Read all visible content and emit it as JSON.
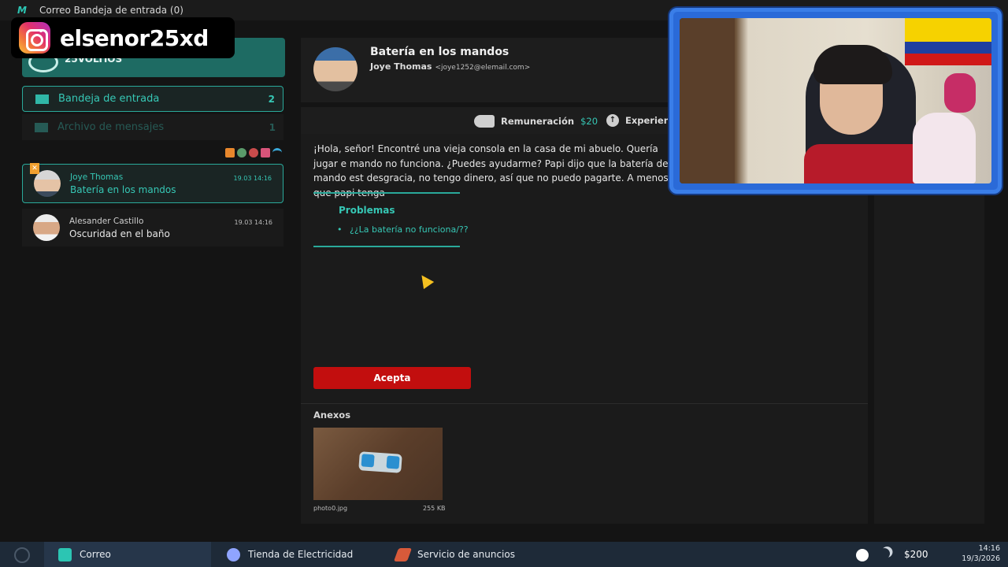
{
  "window": {
    "title": "Correo  Bandeja de entrada (0)",
    "app_logo": "M"
  },
  "overlay": {
    "instagram_handle": "elsenor25xd"
  },
  "sidebar": {
    "brand": "25VOLTIOS",
    "nav": [
      {
        "label": "Bandeja de entrada",
        "count": "2"
      },
      {
        "label": "Archivo de mensajes",
        "count": "1"
      }
    ],
    "status_icons": [
      "rss-icon",
      "globe-icon",
      "mail-icon",
      "heart-icon",
      "wifi-icon"
    ],
    "mails": [
      {
        "from": "Joye Thomas",
        "subject": "Batería en los mandos",
        "date": "19.03 14:16",
        "badge": "✕"
      },
      {
        "from": "Alesander Castillo",
        "subject": "Oscuridad en el baño",
        "date": "19.03 14:16"
      }
    ]
  },
  "message": {
    "subject": "Batería en los mandos",
    "sender_name": "Joye Thomas",
    "sender_email": "<joye1252@elemail.com>",
    "reward_label": "Remuneración",
    "reward_amount": "$20",
    "experience_label": "Experiencia",
    "body": "¡Hola, señor! Encontré una vieja consola en la casa de mi abuelo. Quería jugar e mando no funciona. ¿Puedes ayudarme? Papi dijo que la batería del mando est desgracia, no tengo dinero, así que no puedo pagarte. A menos que papi tenga",
    "problems_title": "Problemas",
    "problems": [
      "¿¿La batería no funciona/??"
    ],
    "accept_label": "Acepta",
    "attachments_title": "Anexos",
    "attachment": {
      "name": "photo0.jpg",
      "size": "255 KB"
    }
  },
  "taskbar": {
    "items": [
      {
        "label": "Correo",
        "icon": "mail-app-icon"
      },
      {
        "label": "Tienda de Electricidad",
        "icon": "shop-icon"
      },
      {
        "label": "Servicio de anuncios",
        "icon": "ads-icon"
      }
    ],
    "money": "$200",
    "time": "14:16",
    "date": "19/3/2026"
  },
  "colors": {
    "accent": "#2aa99a",
    "accept": "#c20e0e",
    "taskbar": "#1e2a38"
  }
}
